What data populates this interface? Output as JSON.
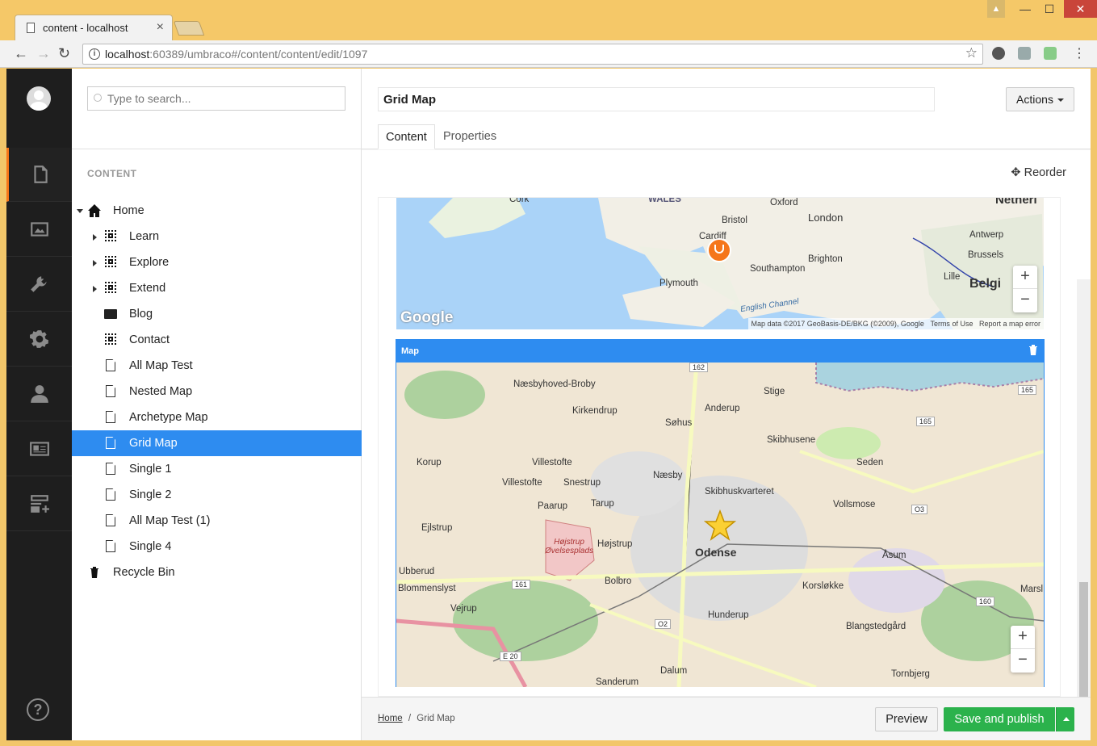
{
  "browser": {
    "tab_title": "content - localhost",
    "url_host": "localhost",
    "url_rest": ":60389/umbraco#/content/content/edit/1097"
  },
  "search": {
    "placeholder": "Type to search..."
  },
  "tree": {
    "header": "CONTENT",
    "nodes": [
      {
        "label": "Home"
      },
      {
        "label": "Learn"
      },
      {
        "label": "Explore"
      },
      {
        "label": "Extend"
      },
      {
        "label": "Blog"
      },
      {
        "label": "Contact"
      },
      {
        "label": "All Map Test"
      },
      {
        "label": "Nested Map"
      },
      {
        "label": "Archetype Map"
      },
      {
        "label": "Grid Map"
      },
      {
        "label": "Single 1"
      },
      {
        "label": "Single 2"
      },
      {
        "label": "All Map Test (1)"
      },
      {
        "label": "Single 4"
      },
      {
        "label": "Recycle Bin"
      }
    ],
    "selected": "Grid Map"
  },
  "editor": {
    "name": "Grid Map",
    "actions_label": "Actions",
    "tabs": [
      {
        "label": "Content"
      },
      {
        "label": "Properties"
      }
    ],
    "reorder_label": "Reorder",
    "map1": {
      "labels": [
        "Cork",
        "WALES",
        "Oxford",
        "Bristol",
        "London",
        "Cardiff",
        "Antwerp",
        "Netherl",
        "Brussels",
        "Southampton",
        "Brighton",
        "Lille",
        "Belgi",
        "Plymouth",
        "English Channel"
      ],
      "logo": "Google",
      "attribution": "Map data ©2017 GeoBasis-DE/BKG (©2009), Google",
      "terms": "Terms of Use",
      "report": "Report a map error"
    },
    "map2": {
      "title": "Map",
      "labels": [
        "Næsbyhoved-Broby",
        "Kirkendrup",
        "Søhus",
        "Anderup",
        "Stige",
        "Skibhusene",
        "Korup",
        "Villestofte",
        "Næsby",
        "Seden",
        "Villestofte",
        "Snestrup",
        "Skibhuskvarteret",
        "Vollsmose",
        "Paarup",
        "Tarup",
        "Ejlstrup",
        "Højstrup",
        "Odense",
        "Højstrup Øvelsesplads",
        "Ubberud",
        "Bolbro",
        "Korsløkke",
        "Åsum",
        "Blommenslyst",
        "Vejrup",
        "Hunderup",
        "Blangstedgård",
        "Marsl",
        "Dalum",
        "Tornbjerg",
        "Sanderum"
      ],
      "road_numbers": [
        "162",
        "165",
        "165",
        "O3",
        "161",
        "160",
        "O2",
        "E 20"
      ]
    },
    "zoom_in": "+",
    "zoom_out": "−"
  },
  "footer": {
    "breadcrumb_home": "Home",
    "breadcrumb_sep": "/",
    "breadcrumb_current": "Grid Map",
    "preview_label": "Preview",
    "publish_label": "Save and publish"
  },
  "colors": {
    "accent": "#2e8cf0",
    "publish": "#2bb24c",
    "active_section": "#f5761a"
  }
}
